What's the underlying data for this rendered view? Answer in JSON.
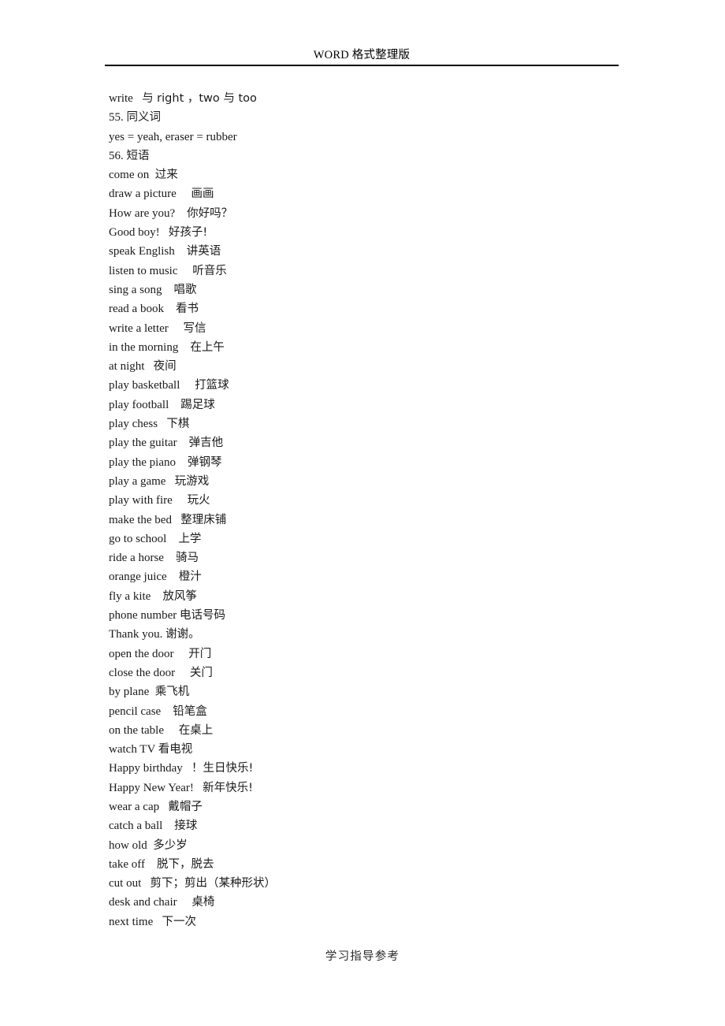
{
  "header": {
    "title": "WORD 格式整理版"
  },
  "footer": {
    "text": "学习指导参考"
  },
  "body": {
    "lines": [
      {
        "en": "write ",
        "gap": "  ",
        "cn": "与 right ，two 与 too"
      },
      {
        "en": "55. ",
        "gap": "",
        "cn": "同义词"
      },
      {
        "en": "yes = yeah, eraser = rubber",
        "gap": "",
        "cn": ""
      },
      {
        "en": "56. ",
        "gap": "",
        "cn": "短语"
      },
      {
        "en": "come on",
        "gap": "  ",
        "cn": "过来"
      },
      {
        "en": "draw a picture",
        "gap": "     ",
        "cn": "画画"
      },
      {
        "en": "How are you?",
        "gap": "    ",
        "cn": "你好吗？"
      },
      {
        "en": "Good boy!",
        "gap": "   ",
        "cn": "好孩子!"
      },
      {
        "en": "speak English",
        "gap": "    ",
        "cn": "讲英语"
      },
      {
        "en": "listen to music",
        "gap": "     ",
        "cn": "听音乐"
      },
      {
        "en": "sing a song",
        "gap": "    ",
        "cn": "唱歌"
      },
      {
        "en": "read a book",
        "gap": "    ",
        "cn": "看书"
      },
      {
        "en": "write a letter",
        "gap": "     ",
        "cn": "写信"
      },
      {
        "en": "in the morning",
        "gap": "    ",
        "cn": "在上午"
      },
      {
        "en": "at night",
        "gap": "   ",
        "cn": "夜间"
      },
      {
        "en": "play basketball",
        "gap": "     ",
        "cn": "打篮球"
      },
      {
        "en": "play football",
        "gap": "    ",
        "cn": "踢足球"
      },
      {
        "en": "play chess",
        "gap": "   ",
        "cn": "下棋"
      },
      {
        "en": "play the guitar",
        "gap": "    ",
        "cn": "弹吉他"
      },
      {
        "en": "play the piano",
        "gap": "    ",
        "cn": "弹钢琴"
      },
      {
        "en": "play a game",
        "gap": "   ",
        "cn": "玩游戏"
      },
      {
        "en": "play with fire",
        "gap": "     ",
        "cn": "玩火"
      },
      {
        "en": "make the bed",
        "gap": "   ",
        "cn": "整理床铺"
      },
      {
        "en": "go to school",
        "gap": "    ",
        "cn": "上学"
      },
      {
        "en": "ride a horse",
        "gap": "    ",
        "cn": "骑马"
      },
      {
        "en": "orange juice",
        "gap": "    ",
        "cn": "橙汁"
      },
      {
        "en": "fly a kite",
        "gap": "    ",
        "cn": "放风筝"
      },
      {
        "en": "phone number",
        "gap": " ",
        "cn": "电话号码"
      },
      {
        "en": "Thank you.",
        "gap": " ",
        "cn": "谢谢。"
      },
      {
        "en": "open the door",
        "gap": "     ",
        "cn": "开门"
      },
      {
        "en": "close the door",
        "gap": "     ",
        "cn": "关门"
      },
      {
        "en": "by plane",
        "gap": "  ",
        "cn": "乘飞机"
      },
      {
        "en": "pencil case",
        "gap": "    ",
        "cn": "铅笔盒"
      },
      {
        "en": "on the table",
        "gap": "     ",
        "cn": "在桌上"
      },
      {
        "en": "watch TV",
        "gap": " ",
        "cn": "看电视"
      },
      {
        "en": "Happy birthday",
        "gap": "   ",
        "cn": "！生日快乐!"
      },
      {
        "en": "Happy New Year!",
        "gap": "   ",
        "cn": "新年快乐!"
      },
      {
        "en": "wear a cap",
        "gap": "   ",
        "cn": "戴帽子"
      },
      {
        "en": "catch a ball",
        "gap": "    ",
        "cn": "接球"
      },
      {
        "en": "how old",
        "gap": "  ",
        "cn": "多少岁"
      },
      {
        "en": "take off",
        "gap": "    ",
        "cn": "脱下，脱去"
      },
      {
        "en": "cut out",
        "gap": "   ",
        "cn": "剪下；剪出（某种形状）"
      },
      {
        "en": "desk and chair",
        "gap": "     ",
        "cn": "桌椅"
      },
      {
        "en": "next time",
        "gap": "   ",
        "cn": "下一次"
      }
    ]
  }
}
